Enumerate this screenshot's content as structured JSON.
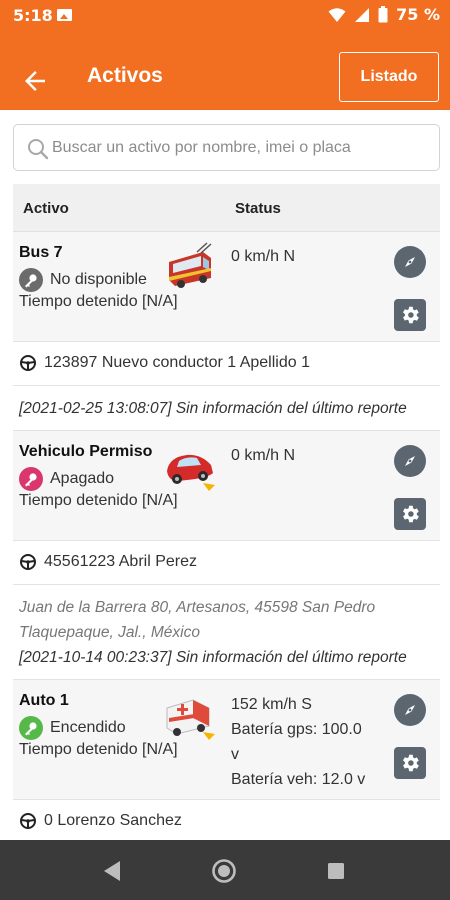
{
  "status_bar": {
    "time": "5:18",
    "battery": "75 %"
  },
  "app_bar": {
    "title": "Activos",
    "listado_label": "Listado"
  },
  "search": {
    "placeholder": "Buscar un activo por nombre, imei o placa"
  },
  "table": {
    "col_activo": "Activo",
    "col_status": "Status"
  },
  "assets": [
    {
      "name": "Bus 7",
      "state": "No disponible",
      "stopped": "Tiempo detenido [N/A]",
      "status_lines": [
        "0 km/h N"
      ],
      "driver": "123897 Nuevo conductor 1 Apellido 1",
      "address_lines": [],
      "report": "[2021-02-25 13:08:07] Sin información del último reporte",
      "icon": "bus-icon",
      "key_color": "#6b6b6b"
    },
    {
      "name": "Vehiculo Permiso",
      "state": "Apagado",
      "stopped": "Tiempo detenido [N/A]",
      "status_lines": [
        "0 km/h N"
      ],
      "driver": "45561223 Abril Perez",
      "address_lines": [
        "Juan de la Barrera 80, Artesanos, 45598 San Pedro",
        "Tlaquepaque, Jal., México"
      ],
      "report": "[2021-10-14 00:23:37] Sin información del último reporte",
      "icon": "car-icon",
      "key_color": "#d9376e"
    },
    {
      "name": "Auto 1",
      "state": "Encendido",
      "stopped": "Tiempo detenido [N/A]",
      "status_lines": [
        "152 km/h S",
        "Batería gps: 100.0",
        "v",
        "Batería veh: 12.0 v"
      ],
      "driver": "0 Lorenzo Sanchez",
      "address_lines": [],
      "report": "",
      "icon": "ambulance-icon",
      "key_color": "#56b848"
    }
  ],
  "colors": {
    "accent": "#f26f21",
    "icon_button": "#5c6670",
    "navbar": "#3a3a3a"
  }
}
